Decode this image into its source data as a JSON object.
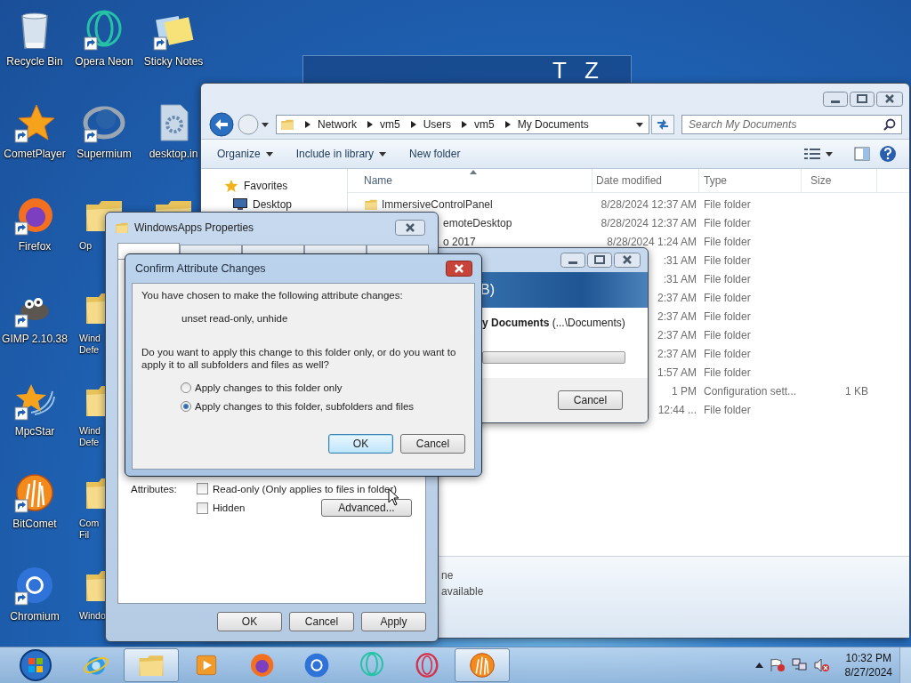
{
  "background_window": {
    "letters": [
      "T",
      "Z"
    ]
  },
  "desktop_icons": [
    [
      {
        "label": "Recycle Bin",
        "kind": "recycle",
        "shortcut": false
      },
      {
        "label": "CometPlayer",
        "kind": "comet",
        "shortcut": true
      },
      {
        "label": "Firefox",
        "kind": "firefox",
        "shortcut": true
      },
      {
        "label": "GIMP 2.10.38",
        "kind": "gimp",
        "shortcut": true
      },
      {
        "label": "MpcStar",
        "kind": "mpcstar",
        "shortcut": true
      },
      {
        "label": "BitComet",
        "kind": "bitcomet",
        "shortcut": true
      },
      {
        "label": "Chromium",
        "kind": "chromium",
        "shortcut": true
      }
    ],
    [
      {
        "label": "Opera Neon",
        "kind": "neon",
        "shortcut": true
      },
      {
        "label": "Supermium",
        "kind": "supermium",
        "shortcut": true
      },
      {
        "label": "Op",
        "kind": "folder",
        "shortcut": false,
        "covered": true
      },
      {
        "label": "Wind Defe",
        "kind": "folder",
        "shortcut": false,
        "covered": true
      },
      {
        "label": "Wind Defe",
        "kind": "folder",
        "shortcut": false,
        "covered": true
      },
      {
        "label": "Com Fil",
        "kind": "folder",
        "shortcut": false,
        "covered": true
      },
      {
        "label": "Windo",
        "kind": "folder",
        "shortcut": false,
        "covered": true
      }
    ],
    [
      {
        "label": "Sticky Notes",
        "kind": "sticky",
        "shortcut": true
      },
      {
        "label": "desktop.in",
        "kind": "ini",
        "shortcut": false
      },
      {
        "kind": "folder"
      }
    ]
  ],
  "explorer": {
    "breadcrumbs": [
      "Network",
      "vm5",
      "Users",
      "vm5",
      "My Documents"
    ],
    "search": {
      "placeholder": "Search My Documents"
    },
    "toolbar": [
      {
        "label": "Organize",
        "dropdown": true
      },
      {
        "label": "Include in library",
        "dropdown": true
      },
      {
        "label": "New folder",
        "dropdown": false
      }
    ],
    "nav": [
      {
        "label": "Favorites",
        "kind": "star"
      },
      {
        "label": "Desktop",
        "kind": "desktop"
      }
    ],
    "columns": [
      {
        "label": "Name",
        "sorted": true
      },
      {
        "label": "Date modified",
        "sorted": false
      },
      {
        "label": "Type",
        "sorted": false
      },
      {
        "label": "Size",
        "sorted": false
      }
    ],
    "rows": [
      {
        "name": "ImmersiveControlPanel",
        "folder_icon": true,
        "date": "8/28/2024 12:37 AM",
        "type": "File folder"
      },
      {
        "name": "emoteDesktop",
        "name_covered": true,
        "date": "8/28/2024 12:37 AM",
        "type": "File folder"
      },
      {
        "name": "o 2017",
        "name_covered": true,
        "date": "8/28/2024 1:24 AM",
        "type": "File folder"
      },
      {
        "date": ":31 AM",
        "type": "File folder"
      },
      {
        "date": ":31 AM",
        "type": "File folder"
      },
      {
        "date": "2:37 AM",
        "type": "File folder"
      },
      {
        "date": "2:37 AM",
        "type": "File folder"
      },
      {
        "date": "2:37 AM",
        "type": "File folder"
      },
      {
        "date": "2:37 AM",
        "type": "File folder"
      },
      {
        "date": "1:57 AM",
        "type": "File folder"
      },
      {
        "date": "1 PM",
        "type": "Configuration sett...",
        "size": "1 KB"
      },
      {
        "date": "12:44 ...",
        "type": "File folder"
      }
    ],
    "details": [
      "ne",
      "available"
    ]
  },
  "copy_dialog": {
    "header": "B)",
    "item": "**y Documents** (...\\Documents)",
    "level": 0,
    "button": "Cancel"
  },
  "properties": {
    "title": "WindowsApps Properties",
    "tabs": [
      {
        "selected": true
      },
      {
        "selected": false
      },
      {
        "selected": false
      },
      {
        "selected": false
      },
      {
        "selected": false
      }
    ],
    "attributes_label": "Attributes:",
    "checkboxes": [
      {
        "label": "Read-only (Only applies to files in folder)",
        "checked": false
      },
      {
        "label": "Hidden",
        "checked": false
      }
    ],
    "advanced_button": "Advanced...",
    "buttons": [
      "OK",
      "Cancel",
      "Apply"
    ]
  },
  "confirm": {
    "title": "Confirm Attribute Changes",
    "intro": "You have chosen to make the following attribute changes:",
    "changes": "unset read-only, unhide",
    "question": "Do you want to apply this change to this folder only, or do you want to apply it to all subfolders and files as well?",
    "options": [
      {
        "label": "Apply changes to this folder only",
        "selected": false
      },
      {
        "label": "Apply changes to this folder, subfolders and files",
        "selected": true
      }
    ],
    "buttons": [
      {
        "label": "OK",
        "default": true
      },
      {
        "label": "Cancel",
        "default": false
      }
    ]
  },
  "taskbar": {
    "items": [
      {
        "kind": "ie",
        "active": false
      },
      {
        "kind": "explorer",
        "active": true
      },
      {
        "kind": "media",
        "active": false
      },
      {
        "kind": "firefox",
        "active": false
      },
      {
        "kind": "chromium",
        "active": false
      },
      {
        "kind": "neon",
        "active": false
      },
      {
        "kind": "opera",
        "active": false
      },
      {
        "kind": "bitcomet",
        "active": true
      }
    ],
    "time": "10:32 PM",
    "date": "8/27/2024"
  }
}
